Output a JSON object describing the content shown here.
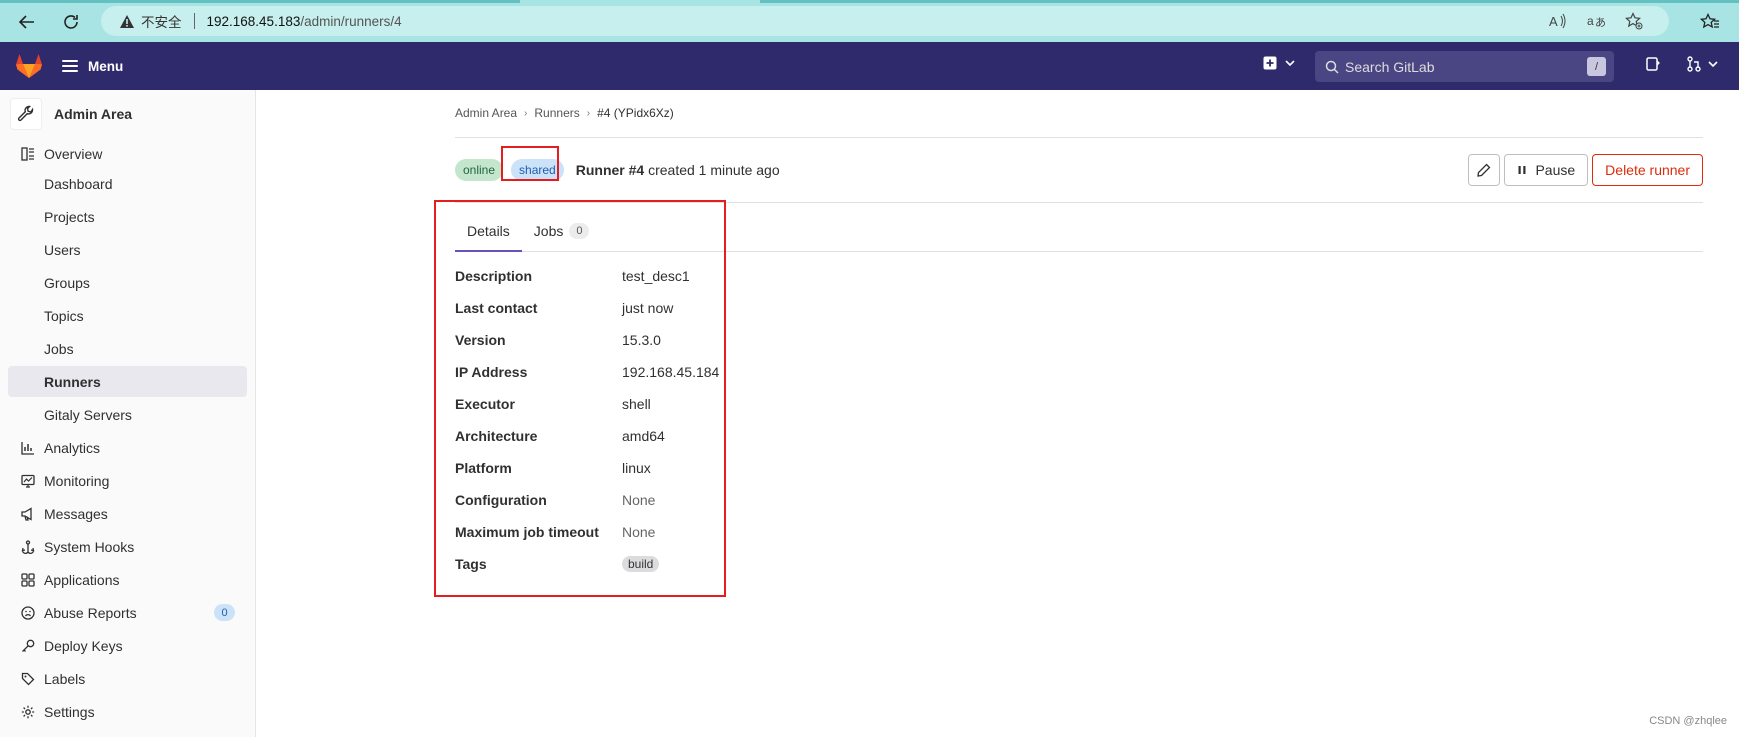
{
  "browser": {
    "insecure_label": "不安全",
    "url_host": "192.168.45.183",
    "url_path": "/admin/runners/4"
  },
  "topbar": {
    "menu_label": "Menu",
    "search_placeholder": "Search GitLab",
    "search_shortcut": "/"
  },
  "sidebar": {
    "title": "Admin Area",
    "items": [
      {
        "label": "Overview",
        "icon": "overview-icon"
      },
      {
        "label": "Dashboard"
      },
      {
        "label": "Projects"
      },
      {
        "label": "Users"
      },
      {
        "label": "Groups"
      },
      {
        "label": "Topics"
      },
      {
        "label": "Jobs"
      },
      {
        "label": "Runners",
        "active": true
      },
      {
        "label": "Gitaly Servers"
      },
      {
        "label": "Analytics",
        "icon": "analytics-icon"
      },
      {
        "label": "Monitoring",
        "icon": "monitoring-icon"
      },
      {
        "label": "Messages",
        "icon": "messages-icon"
      },
      {
        "label": "System Hooks",
        "icon": "hook-icon"
      },
      {
        "label": "Applications",
        "icon": "applications-icon"
      },
      {
        "label": "Abuse Reports",
        "icon": "abuse-icon",
        "count": "0"
      },
      {
        "label": "Deploy Keys",
        "icon": "key-icon"
      },
      {
        "label": "Labels",
        "icon": "label-icon"
      },
      {
        "label": "Settings",
        "icon": "settings-icon"
      }
    ]
  },
  "breadcrumb": {
    "items": [
      "Admin Area",
      "Runners",
      "#4 (YPidx6Xz)"
    ]
  },
  "runner": {
    "status_badge": "online",
    "type_badge": "shared",
    "name": "Runner #4",
    "created_text": "created 1 minute ago",
    "pause_label": "Pause",
    "delete_label": "Delete runner"
  },
  "tabs": [
    {
      "label": "Details",
      "active": true
    },
    {
      "label": "Jobs",
      "count": "0"
    }
  ],
  "details": [
    {
      "key": "Description",
      "value": "test_desc1"
    },
    {
      "key": "Last contact",
      "value": "just now"
    },
    {
      "key": "Version",
      "value": "15.3.0"
    },
    {
      "key": "IP Address",
      "value": "192.168.45.184"
    },
    {
      "key": "Executor",
      "value": "shell"
    },
    {
      "key": "Architecture",
      "value": "amd64"
    },
    {
      "key": "Platform",
      "value": "linux"
    },
    {
      "key": "Configuration",
      "value": "None"
    },
    {
      "key": "Maximum job timeout",
      "value": "None"
    },
    {
      "key": "Tags",
      "value": "build"
    }
  ],
  "watermark": "CSDN @zhqlee",
  "colors": {
    "topbar": "#2f2a6b",
    "browser_bar": "#a7e4e3",
    "annotation": "#e41e1e",
    "danger": "#dd2b0e",
    "tab_active": "#6b4fbb"
  }
}
